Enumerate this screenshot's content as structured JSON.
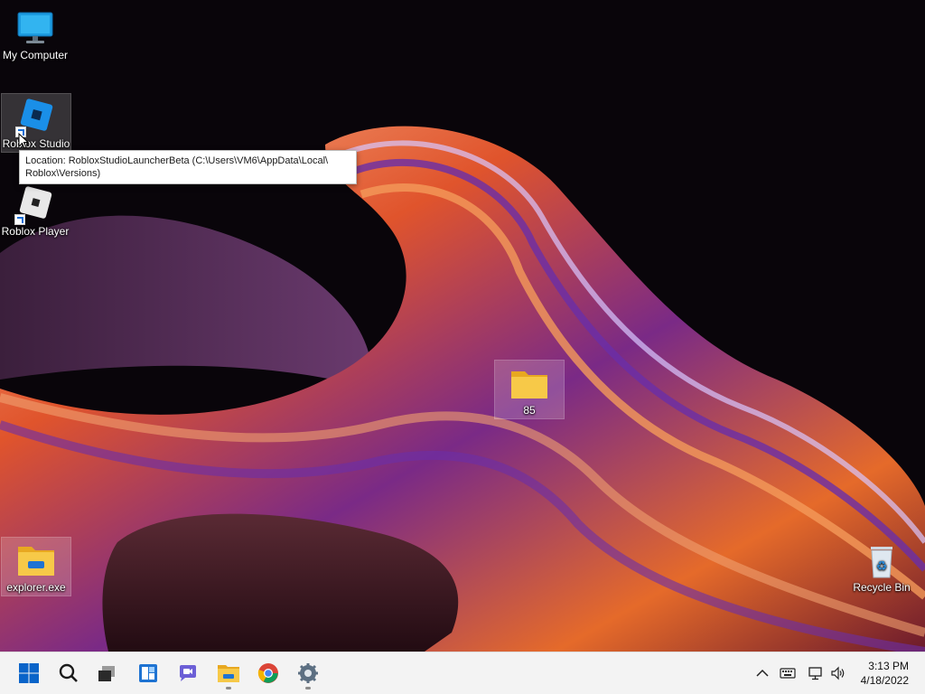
{
  "desktop": {
    "icons": {
      "my_computer": "My Computer",
      "roblox_studio": "Roblox Studio",
      "roblox_player": "Roblox Player",
      "folder_85": "85",
      "explorer": "explorer.exe",
      "recycle_bin": "Recycle Bin"
    },
    "tooltip": {
      "line1": "Location: RobloxStudioLauncherBeta (C:\\Users\\VM6\\AppData\\Local\\",
      "line2": "Roblox\\Versions)"
    }
  },
  "taskbar": {
    "items": [
      "start-icon",
      "search-icon",
      "task-view-icon",
      "widgets-icon",
      "chat-icon",
      "file-explorer-icon",
      "chrome-icon",
      "settings-icon"
    ],
    "tray": {
      "icons": [
        "chevron-up-icon",
        "keyboard-icon",
        "network-icon",
        "volume-icon"
      ]
    },
    "clock": {
      "time": "3:13 PM",
      "date": "4/18/2022"
    }
  },
  "colors": {
    "taskbar_bg": "#f3f3f3",
    "accent_blue": "#0a64c9",
    "folder_yellow": "#f5c542"
  }
}
